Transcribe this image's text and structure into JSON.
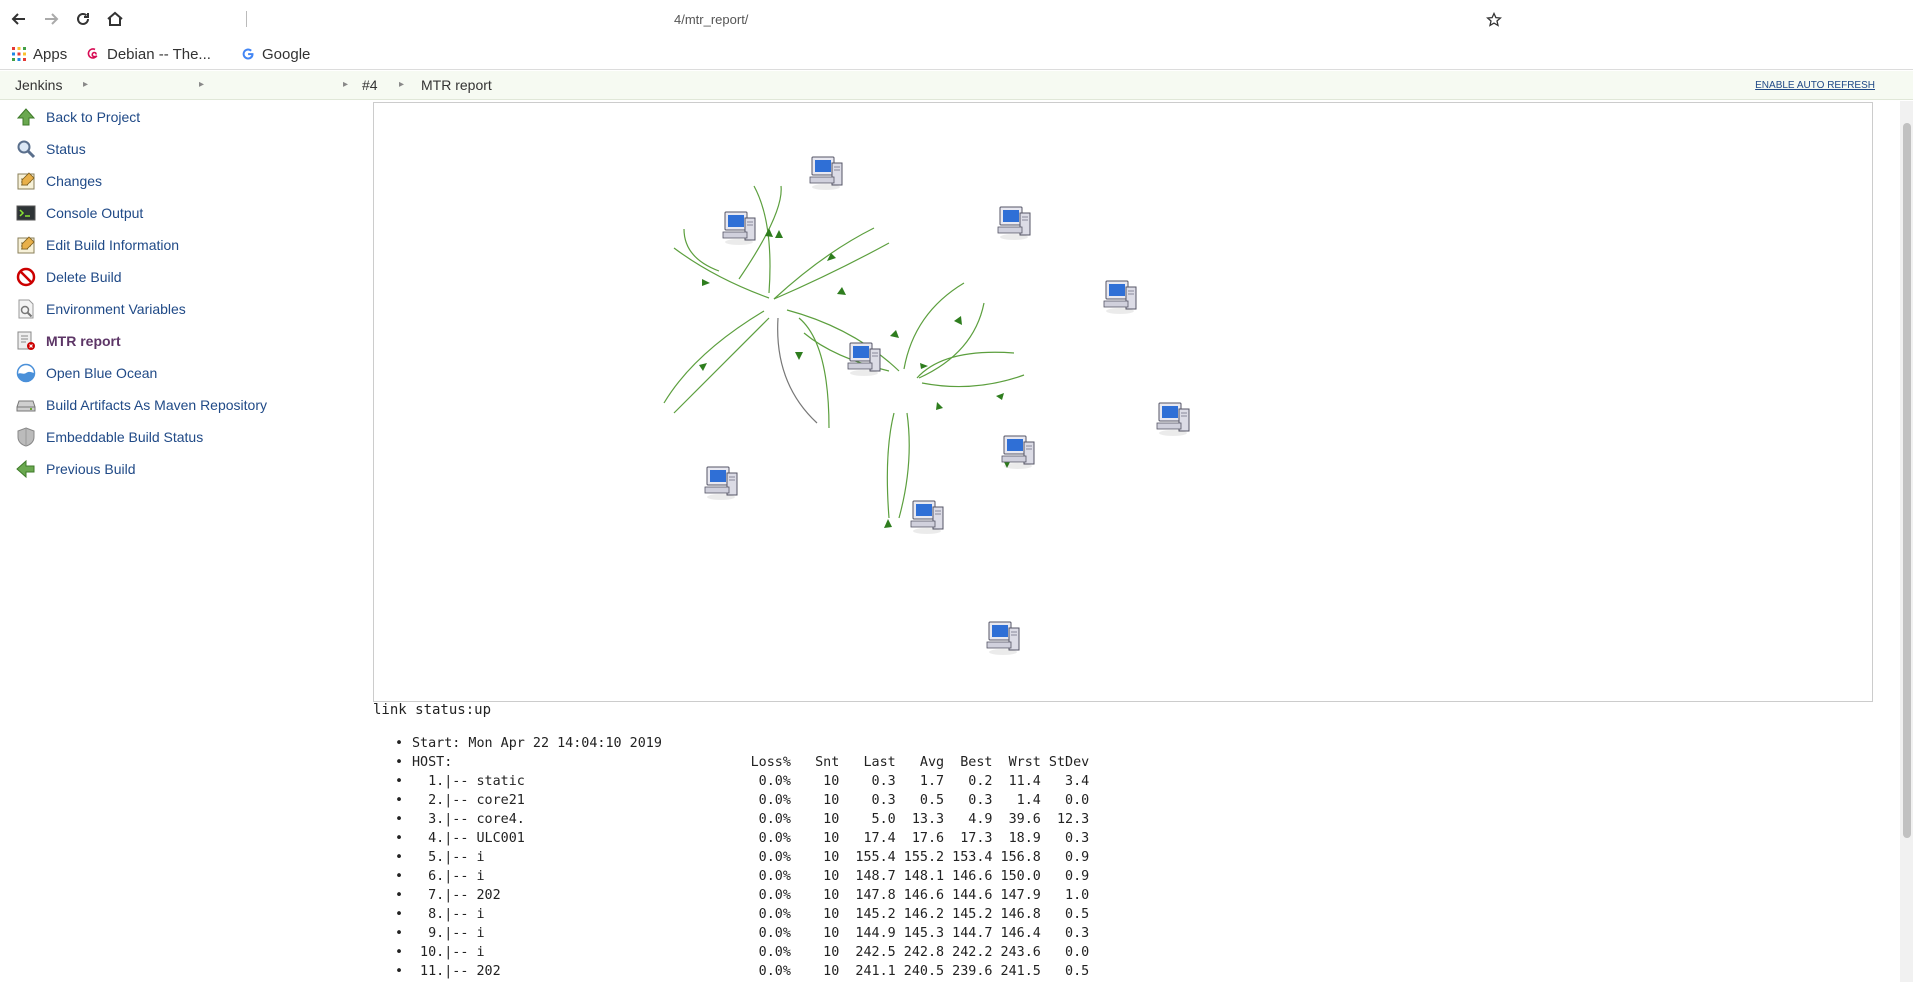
{
  "browser": {
    "url": "4/mtr_report/",
    "bookmarks": [
      {
        "label": "Apps",
        "icon": "apps-grid-icon"
      },
      {
        "label": "Debian -- The...",
        "icon": "debian-logo-icon"
      },
      {
        "label": "Google",
        "icon": "google-logo-icon"
      }
    ]
  },
  "breadcrumb": {
    "items": [
      "Jenkins",
      "#4",
      "MTR report"
    ],
    "auto_refresh": "ENABLE AUTO REFRESH"
  },
  "sidebar": {
    "items": [
      {
        "label": "Back to Project",
        "icon": "up-arrow-icon"
      },
      {
        "label": "Status",
        "icon": "magnifier-icon"
      },
      {
        "label": "Changes",
        "icon": "notepad-icon"
      },
      {
        "label": "Console Output",
        "icon": "terminal-icon"
      },
      {
        "label": "Edit Build Information",
        "icon": "notepad-icon"
      },
      {
        "label": "Delete Build",
        "icon": "no-entry-icon"
      },
      {
        "label": "Environment Variables",
        "icon": "document-search-icon"
      },
      {
        "label": "MTR report",
        "icon": "report-icon"
      },
      {
        "label": "Open Blue Ocean",
        "icon": "blue-ocean-icon"
      },
      {
        "label": "Build Artifacts As Maven Repository",
        "icon": "hard-drive-icon"
      },
      {
        "label": "Embeddable Build Status",
        "icon": "shield-icon"
      },
      {
        "label": "Previous Build",
        "icon": "left-arrow-icon"
      }
    ]
  },
  "report": {
    "link_status": "link status:up",
    "lines": [
      "Start: Mon Apr 22 14:04:10 2019",
      "HOST:                                     Loss%   Snt   Last   Avg  Best  Wrst StDev",
      "  1.|-- static                             0.0%    10    0.3   1.7   0.2  11.4   3.4",
      "  2.|-- core21                             0.0%    10    0.3   0.5   0.3   1.4   0.0",
      "  3.|-- core4.                             0.0%    10    5.0  13.3   4.9  39.6  12.3",
      "  4.|-- ULC001                             0.0%    10   17.4  17.6  17.3  18.9   0.3",
      "  5.|-- i                                  0.0%    10  155.4 155.2 153.4 156.8   0.9",
      "  6.|-- i                                  0.0%    10  148.7 148.1 146.6 150.0   0.9",
      "  7.|-- 202                                0.0%    10  147.8 146.6 144.6 147.9   1.0",
      "  8.|-- i                                  0.0%    10  145.2 146.2 145.2 146.8   0.5",
      "  9.|-- i                                  0.0%    10  144.9 145.3 144.7 146.4   0.3",
      " 10.|-- i                                  0.0%    10  242.5 242.8 242.2 243.6   0.0",
      " 11.|-- 202                                0.0%    10  241.1 240.5 239.6 241.5   0.5"
    ]
  },
  "colors": {
    "edge": "#5c9f3e",
    "edge_gray": "#777777",
    "link": "#204a87"
  }
}
